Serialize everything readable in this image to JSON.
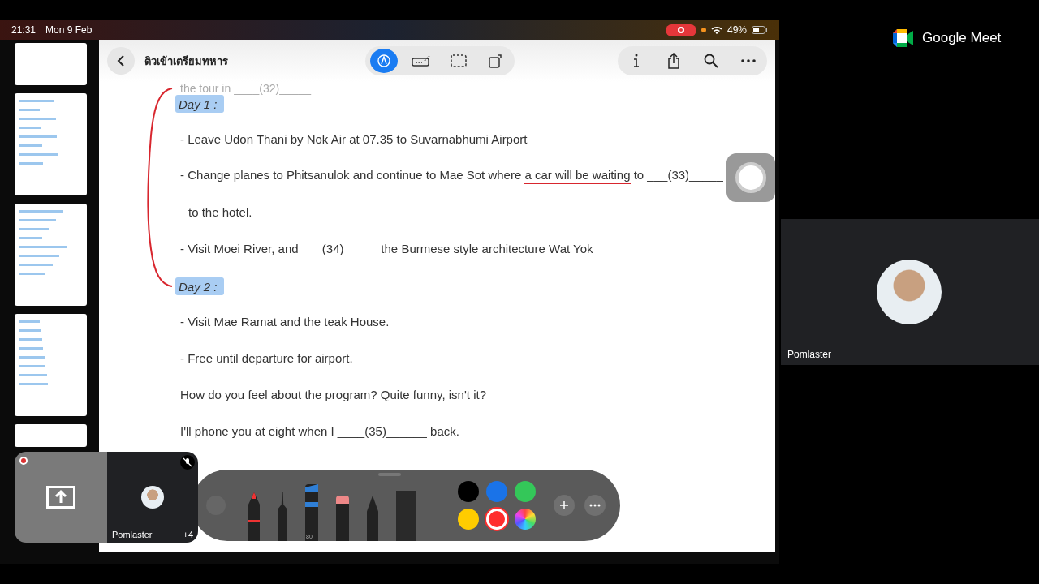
{
  "status_bar": {
    "time": "21:31",
    "date": "Mon 9 Feb",
    "battery": "49%"
  },
  "document": {
    "title": "ติวเข้าเตรียมทหาร",
    "faded_line": "the tour in ____(32)_____",
    "lines": [
      {
        "kind": "heading",
        "segments": [
          {
            "text": "Day 1 :",
            "underlined": false
          }
        ]
      },
      {
        "kind": "text",
        "segments": [
          {
            "text": "- Leave Udon Thani by Nok Air at 07.35 to Suvarnabhumi Airport",
            "underlined": false
          }
        ]
      },
      {
        "kind": "text",
        "segments": [
          {
            "text": "- Change planes to Phitsanulok and continue to Mae Sot where ",
            "underlined": false
          },
          {
            "text": "a car will be waiting",
            "underlined": true
          },
          {
            "text": " to ___(33)_____",
            "underlined": false
          }
        ]
      },
      {
        "kind": "indent",
        "segments": [
          {
            "text": "to the hotel.",
            "underlined": false
          }
        ]
      },
      {
        "kind": "text",
        "segments": [
          {
            "text": "- Visit Moei River, and ___(34)_____ the Burmese style architecture Wat Yok",
            "underlined": false
          }
        ]
      },
      {
        "kind": "heading",
        "segments": [
          {
            "text": "Day 2 :",
            "underlined": false
          }
        ]
      },
      {
        "kind": "text",
        "segments": [
          {
            "text": "- Visit Mae Ramat and the teak House.",
            "underlined": false
          }
        ]
      },
      {
        "kind": "text",
        "segments": [
          {
            "text": "- Free until departure for airport.",
            "underlined": false
          }
        ]
      },
      {
        "kind": "text",
        "segments": [
          {
            "text": "How do you feel about the program? Quite funny, isn't it?",
            "underlined": false
          }
        ]
      },
      {
        "kind": "text",
        "segments": [
          {
            "text": "I'll phone you at eight when I ____(35)______ back.",
            "underlined": false
          }
        ]
      }
    ]
  },
  "markup_tools": [
    {
      "kind": "pen",
      "selected": true
    },
    {
      "kind": "signature",
      "selected": false
    },
    {
      "kind": "select",
      "selected": false
    },
    {
      "kind": "rotate",
      "selected": false
    }
  ],
  "palette": {
    "marker_label": "80",
    "colors": [
      {
        "color": "#000000",
        "selected": false
      },
      {
        "color": "#1a73e8",
        "selected": false
      },
      {
        "color": "#34c759",
        "selected": false
      },
      {
        "color": "#ffcc00",
        "selected": false
      },
      {
        "color": "#ff2d2d",
        "selected": true
      }
    ]
  },
  "pip": {
    "name": "Pomlaster",
    "count": "+4"
  },
  "meet": {
    "brand": "Google Meet",
    "participant": "Pomlaster"
  }
}
